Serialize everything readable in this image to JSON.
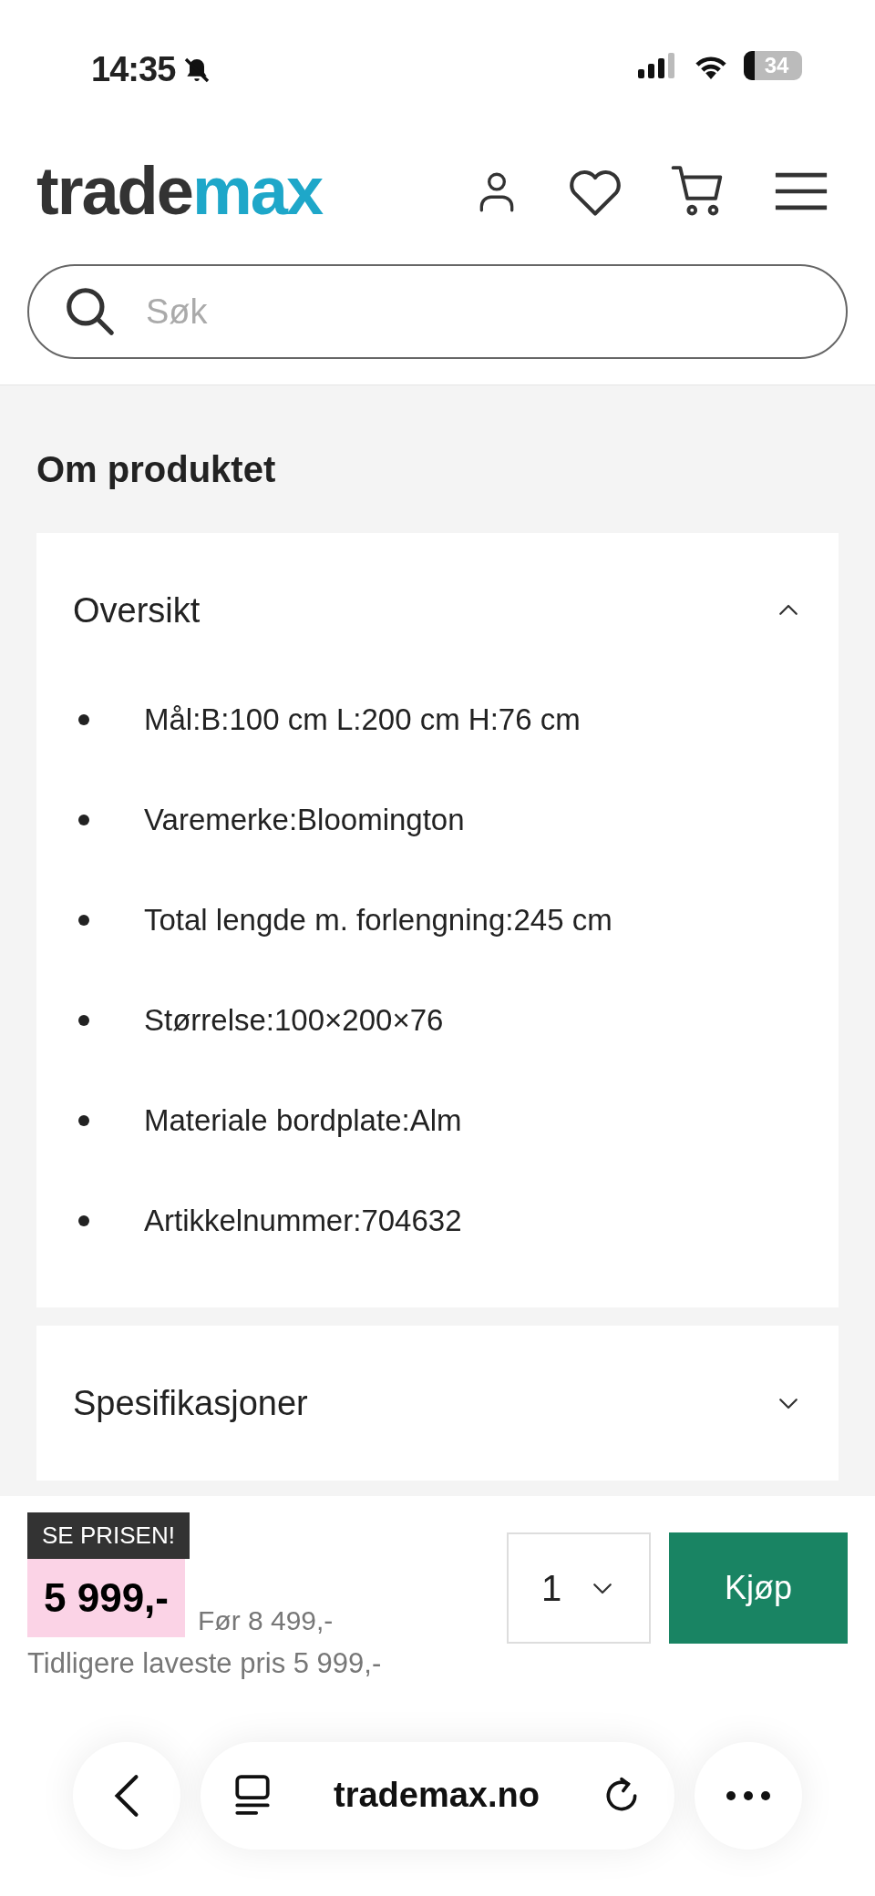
{
  "status_bar": {
    "time": "14:35",
    "battery": "34"
  },
  "header": {
    "logo": [
      {
        "text": "trade",
        "color": "#333333"
      },
      {
        "text": "max",
        "color": "#1ea7c9"
      }
    ],
    "search": {
      "placeholder": "Søk"
    }
  },
  "section_title": "Om produktet",
  "accordions": [
    {
      "title": "Oversikt",
      "expanded": true,
      "items": [
        "Mål:B:100 cm L:200 cm H:76 cm",
        "Varemerke:Bloomington",
        "Total lengde m. forlengning:245 cm",
        "Størrelse:100×200×76",
        "Materiale bordplate:Alm",
        "Artikkelnummer:704632"
      ]
    },
    {
      "title": "Spesifikasjoner",
      "expanded": false
    }
  ],
  "purchase": {
    "badge": "SE PRISEN!",
    "price": "5 999,-",
    "before": "Før 8 499,-",
    "lowest": "Tidligere laveste pris 5 999,-",
    "quantity": "1",
    "buy": "Kjøp"
  },
  "browser": {
    "url": "trademax.no"
  }
}
